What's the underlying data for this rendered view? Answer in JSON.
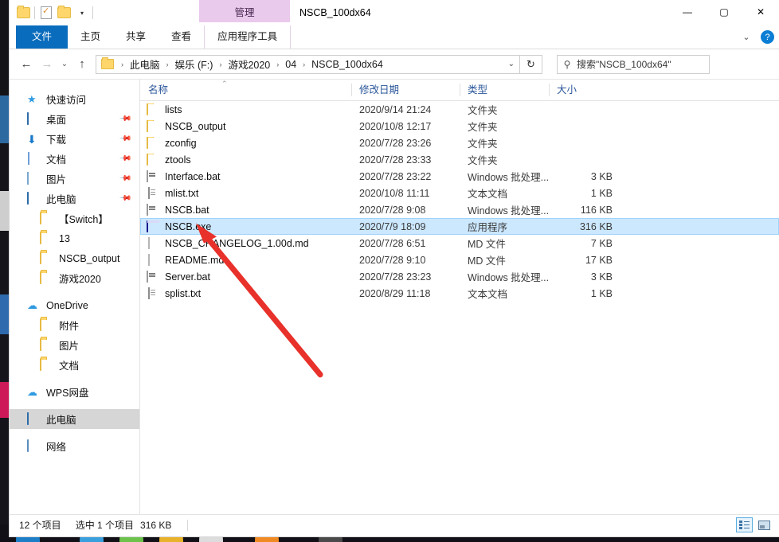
{
  "window": {
    "title": "NSCB_100dx64",
    "contextual_tab_group": "管理",
    "controls": {
      "minimize": "—",
      "maximize": "▢",
      "close": "✕"
    }
  },
  "quick_access_toolbar": {
    "items": [
      {
        "name": "folder-icon",
        "label": ""
      },
      {
        "name": "properties-icon",
        "label": ""
      },
      {
        "name": "new-folder-icon",
        "label": ""
      },
      {
        "name": "customize-caret",
        "label": "▾"
      }
    ]
  },
  "ribbon": {
    "tabs": [
      {
        "label": "文件",
        "active": true
      },
      {
        "label": "主页",
        "active": false
      },
      {
        "label": "共享",
        "active": false
      },
      {
        "label": "查看",
        "active": false
      },
      {
        "label": "应用程序工具",
        "active": false,
        "contextual": true
      }
    ],
    "collapse_caret": "⌄",
    "help": "?"
  },
  "navigation": {
    "back": "←",
    "forward": "→",
    "recent_caret": "⌄",
    "up": "↑",
    "refresh": "↻",
    "dropdown_caret": "⌄"
  },
  "breadcrumb": {
    "segments": [
      "此电脑",
      "娱乐 (F:)",
      "游戏2020",
      "04",
      "NSCB_100dx64"
    ],
    "separator": "›"
  },
  "search": {
    "icon": "search-icon",
    "placeholder": "搜索\"NSCB_100dx64\""
  },
  "sidebar": {
    "items": [
      {
        "label": "快速访问",
        "icon": "star-icon",
        "indent": false,
        "pinned": false,
        "selected": false
      },
      {
        "label": "桌面",
        "icon": "desktop-icon",
        "indent": false,
        "pinned": true,
        "selected": false
      },
      {
        "label": "下载",
        "icon": "download-icon",
        "indent": false,
        "pinned": true,
        "selected": false
      },
      {
        "label": "文档",
        "icon": "documents-icon",
        "indent": false,
        "pinned": true,
        "selected": false
      },
      {
        "label": "图片",
        "icon": "pictures-icon",
        "indent": false,
        "pinned": true,
        "selected": false
      },
      {
        "label": "此电脑",
        "icon": "this-pc-icon",
        "indent": false,
        "pinned": true,
        "selected": false
      },
      {
        "label": "【Switch】",
        "icon": "folder-icon",
        "indent": true,
        "pinned": false,
        "selected": false
      },
      {
        "label": "13",
        "icon": "folder-icon",
        "indent": true,
        "pinned": false,
        "selected": false
      },
      {
        "label": "NSCB_output",
        "icon": "folder-icon",
        "indent": true,
        "pinned": false,
        "selected": false
      },
      {
        "label": "游戏2020",
        "icon": "folder-icon",
        "indent": true,
        "pinned": false,
        "selected": false
      },
      {
        "label": "OneDrive",
        "icon": "cloud-icon",
        "indent": false,
        "pinned": false,
        "selected": false,
        "group_before": true
      },
      {
        "label": "附件",
        "icon": "folder-icon",
        "indent": true,
        "pinned": false,
        "selected": false
      },
      {
        "label": "图片",
        "icon": "folder-icon",
        "indent": true,
        "pinned": false,
        "selected": false
      },
      {
        "label": "文档",
        "icon": "folder-icon",
        "indent": true,
        "pinned": false,
        "selected": false
      },
      {
        "label": "WPS网盘",
        "icon": "cloud-icon",
        "indent": false,
        "pinned": false,
        "selected": false,
        "group_before": true
      },
      {
        "label": "此电脑",
        "icon": "this-pc-icon",
        "indent": false,
        "pinned": false,
        "selected": true,
        "group_before": true
      },
      {
        "label": "网络",
        "icon": "network-icon",
        "indent": false,
        "pinned": false,
        "selected": false,
        "group_before": true
      }
    ]
  },
  "file_list": {
    "columns": [
      {
        "label": "名称",
        "key": "name"
      },
      {
        "label": "修改日期",
        "key": "date"
      },
      {
        "label": "类型",
        "key": "type"
      },
      {
        "label": "大小",
        "key": "size"
      }
    ],
    "sort_indicator": "⌃",
    "rows": [
      {
        "name": "lists",
        "date": "2020/9/14 21:24",
        "type": "文件夹",
        "size": "",
        "icon": "folder-icon",
        "selected": false
      },
      {
        "name": "NSCB_output",
        "date": "2020/10/8 12:17",
        "type": "文件夹",
        "size": "",
        "icon": "folder-icon",
        "selected": false
      },
      {
        "name": "zconfig",
        "date": "2020/7/28 23:26",
        "type": "文件夹",
        "size": "",
        "icon": "folder-icon",
        "selected": false
      },
      {
        "name": "ztools",
        "date": "2020/7/28 23:33",
        "type": "文件夹",
        "size": "",
        "icon": "folder-icon",
        "selected": false
      },
      {
        "name": "Interface.bat",
        "date": "2020/7/28 23:22",
        "type": "Windows 批处理...",
        "size": "3 KB",
        "icon": "bat-icon",
        "selected": false
      },
      {
        "name": "mlist.txt",
        "date": "2020/10/8 11:11",
        "type": "文本文档",
        "size": "1 KB",
        "icon": "txt-icon",
        "selected": false
      },
      {
        "name": "NSCB.bat",
        "date": "2020/7/28 9:08",
        "type": "Windows 批处理...",
        "size": "116 KB",
        "icon": "bat-icon",
        "selected": false
      },
      {
        "name": "NSCB.exe",
        "date": "2020/7/9 18:09",
        "type": "应用程序",
        "size": "316 KB",
        "icon": "exe-icon",
        "selected": true
      },
      {
        "name": "NSCB_CHANGELOG_1.00d.md",
        "date": "2020/7/28 6:51",
        "type": "MD 文件",
        "size": "7 KB",
        "icon": "md-icon",
        "selected": false
      },
      {
        "name": "README.md",
        "date": "2020/7/28 9:10",
        "type": "MD 文件",
        "size": "17 KB",
        "icon": "md-icon",
        "selected": false
      },
      {
        "name": "Server.bat",
        "date": "2020/7/28 23:23",
        "type": "Windows 批处理...",
        "size": "3 KB",
        "icon": "bat-icon",
        "selected": false
      },
      {
        "name": "splist.txt",
        "date": "2020/8/29 11:18",
        "type": "文本文档",
        "size": "1 KB",
        "icon": "txt-icon",
        "selected": false
      }
    ]
  },
  "status_bar": {
    "item_count": "12 个项目",
    "selection": "选中 1 个项目",
    "selection_size": "316 KB",
    "views": [
      {
        "name": "details-view-button",
        "active": true
      },
      {
        "name": "large-icons-view-button",
        "active": false
      }
    ]
  },
  "annotation": {
    "type": "arrow",
    "color": "#e8312a",
    "points_to": "NSCB.exe"
  },
  "colors": {
    "accent": "#0a6cbd",
    "contextual_tab": "#e9c9ec",
    "selection": "#cce8ff",
    "header_text": "#2b579a",
    "annotation": "#e8312a"
  }
}
